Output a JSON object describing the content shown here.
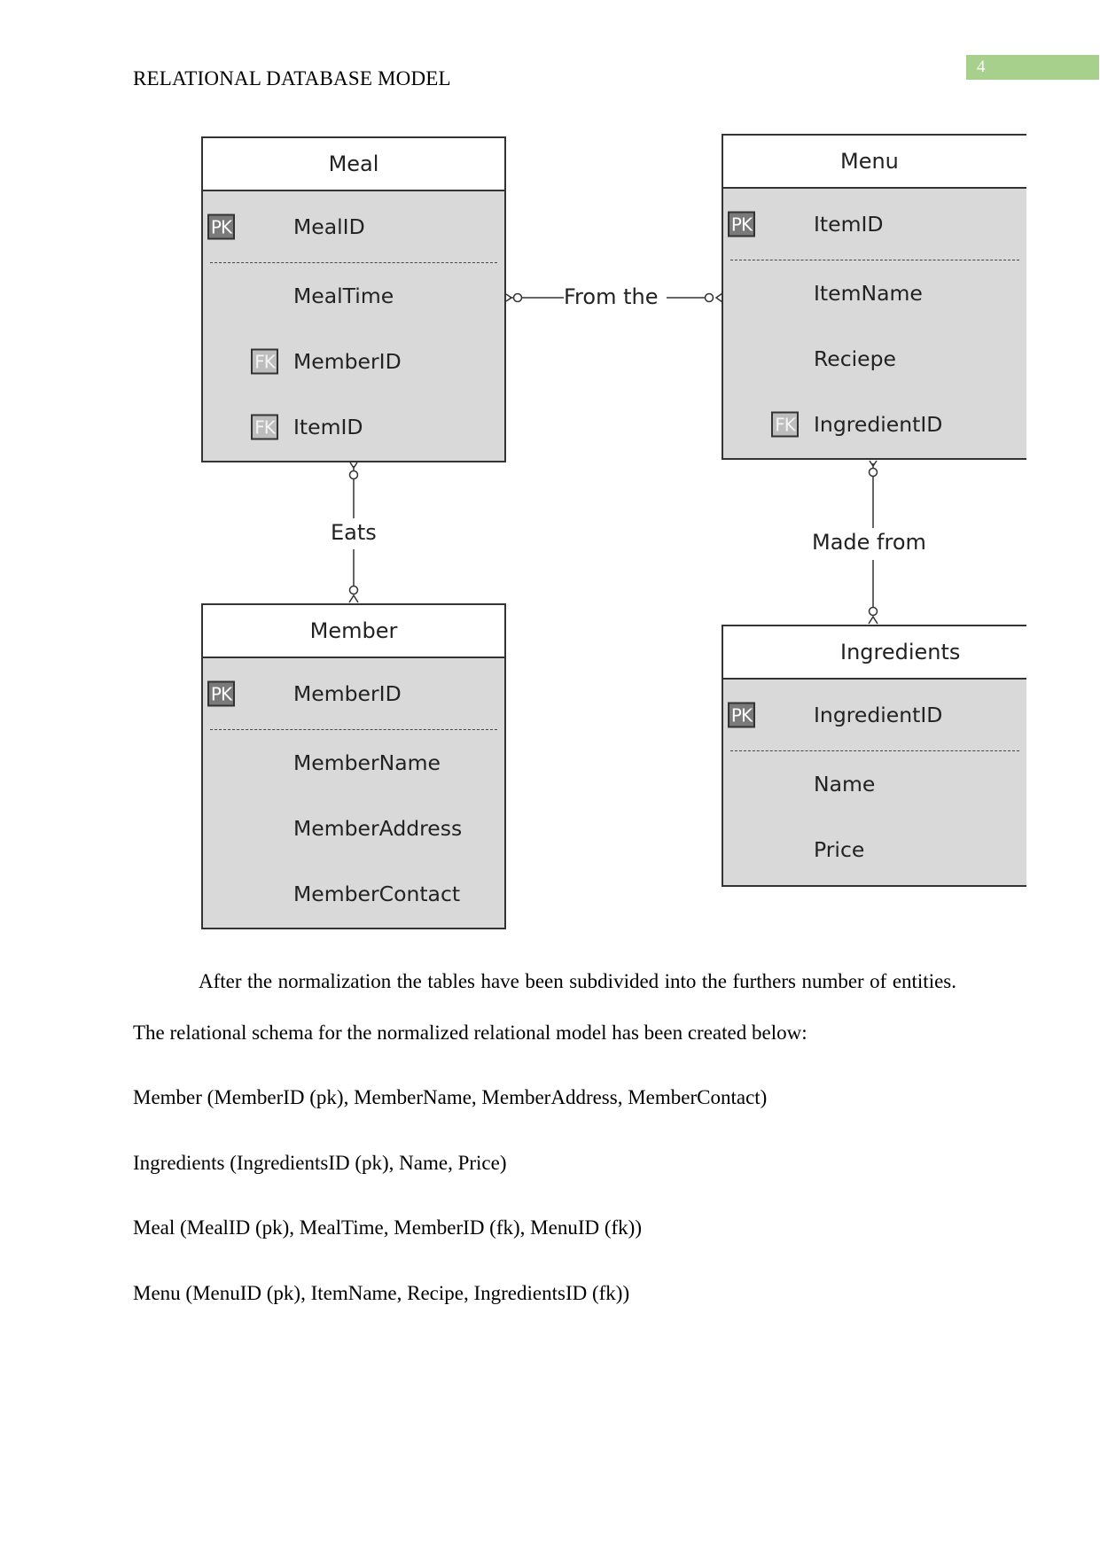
{
  "header": {
    "running_title": "RELATIONAL DATABASE MODEL",
    "page_number": "4",
    "page_number_bg": "#a8d08d"
  },
  "diagram": {
    "entities": {
      "meal": {
        "title": "Meal",
        "primary_key": {
          "badge": "PK",
          "name": "MealID"
        },
        "attributes": [
          {
            "badge": "",
            "name": "MealTime"
          },
          {
            "badge": "FK",
            "name": "MemberID"
          },
          {
            "badge": "FK",
            "name": "ItemID"
          }
        ]
      },
      "menu": {
        "title": "Menu",
        "primary_key": {
          "badge": "PK",
          "name": "ItemID"
        },
        "attributes": [
          {
            "badge": "",
            "name": "ItemName"
          },
          {
            "badge": "",
            "name": "Reciepe"
          },
          {
            "badge": "FK",
            "name": "IngredientID"
          }
        ]
      },
      "member": {
        "title": "Member",
        "primary_key": {
          "badge": "PK",
          "name": "MemberID"
        },
        "attributes": [
          {
            "badge": "",
            "name": "MemberName"
          },
          {
            "badge": "",
            "name": "MemberAddress"
          },
          {
            "badge": "",
            "name": "MemberContact"
          }
        ]
      },
      "ingredients": {
        "title": "Ingredients",
        "primary_key": {
          "badge": "PK",
          "name": "IngredientID"
        },
        "attributes": [
          {
            "badge": "",
            "name": "Name"
          },
          {
            "badge": "",
            "name": "Price"
          }
        ]
      }
    },
    "relationships": [
      {
        "label": "From the",
        "from": "Meal",
        "to": "Menu",
        "notation": "zero-or-many to zero-or-many"
      },
      {
        "label": "Eats",
        "from": "Meal",
        "to": "Member",
        "notation": "zero-or-many to zero-or-many"
      },
      {
        "label": "Made from",
        "from": "Menu",
        "to": "Ingredients",
        "notation": "zero-or-many to zero-or-many"
      }
    ]
  },
  "body": {
    "paragraph": "After the normalization the tables have been subdivided into the furthers number of entities. The relational schema for the normalized relational model has been created below:",
    "schema_lines": [
      "Member (MemberID (pk), MemberName, MemberAddress, MemberContact)",
      "Ingredients (IngredientsID (pk), Name, Price)",
      "Meal (MealID (pk), MealTime, MemberID (fk), MenuID (fk))",
      "Menu (MenuID (pk), ItemName, Recipe, IngredientsID (fk))"
    ]
  }
}
